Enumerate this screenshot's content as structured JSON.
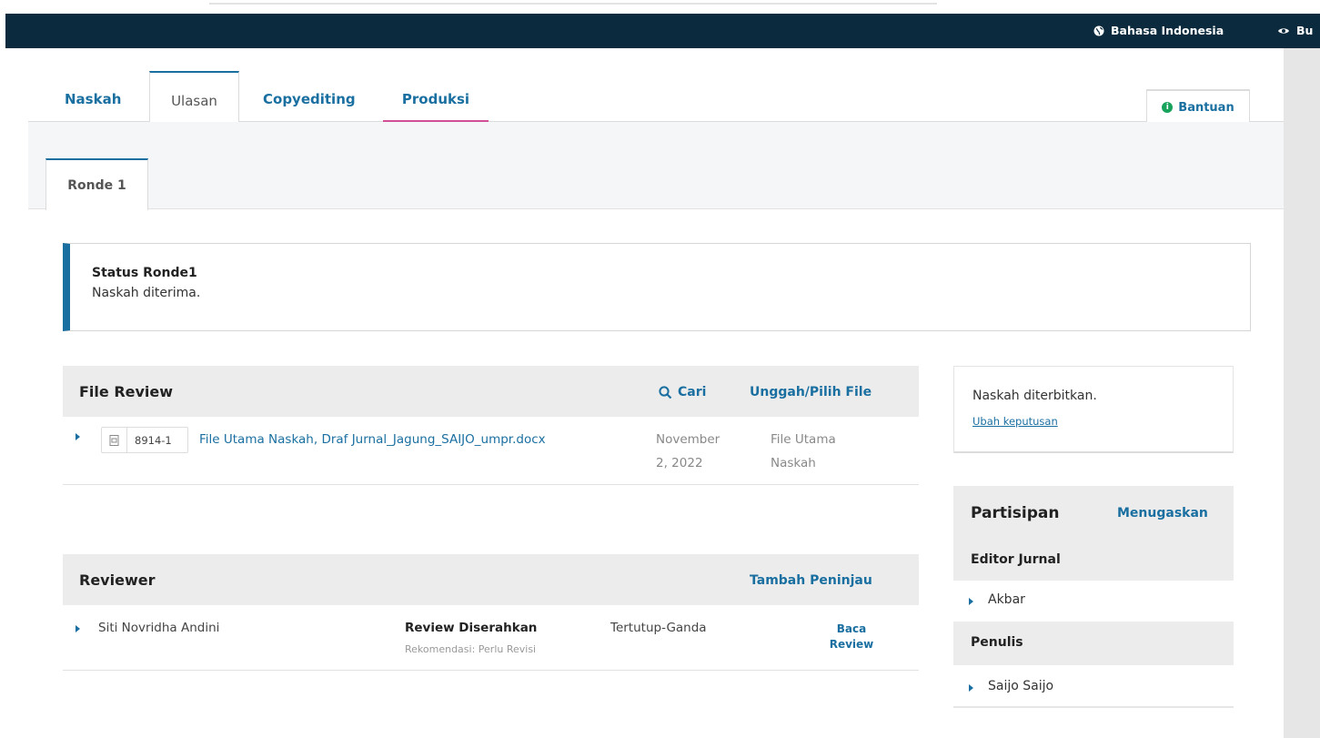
{
  "header": {
    "language_label": "Bahasa Indonesia",
    "view_label": "Bu",
    "globe_icon": "globe-icon",
    "eye_icon": "eye-icon"
  },
  "tabs": {
    "naskah": "Naskah",
    "ulasan": "Ulasan",
    "copyediting": "Copyediting",
    "produksi": "Produksi",
    "help": "Bantuan"
  },
  "round": {
    "tab_label": "Ronde 1",
    "status_title": "Status Ronde1",
    "status_text": "Naskah diterima."
  },
  "file_review": {
    "title": "File Review",
    "search_label": "Cari",
    "upload_label": "Unggah/Pilih File",
    "files": [
      {
        "id": "8914-1",
        "name": "File Utama Naskah, Draf Jurnal_Jagung_SAIJO_umpr.docx",
        "date_line1": "November",
        "date_line2": "2, 2022",
        "type_line1": "File Utama",
        "type_line2": "Naskah"
      }
    ]
  },
  "reviewer": {
    "title": "Reviewer",
    "add_label": "Tambah Peninjau",
    "rows": [
      {
        "name": "Siti Novridha Andini",
        "status": "Review Diserahkan",
        "recommendation": "Rekomendasi: Perlu Revisi",
        "method": "Tertutup-Ganda",
        "action_line1": "Baca",
        "action_line2": "Review"
      }
    ]
  },
  "decision": {
    "text": "Naskah diterbitkan.",
    "change_link": "Ubah keputusan"
  },
  "participants": {
    "title": "Partisipan",
    "assign_label": "Menugaskan",
    "groups": [
      {
        "name": "Editor Jurnal",
        "members": [
          "Akbar"
        ]
      },
      {
        "name": "Penulis",
        "members": [
          "Saijo Saijo"
        ]
      }
    ]
  },
  "colors": {
    "header_bg": "#0c2a3d",
    "link_blue": "#1a6fa1",
    "produksi_underline": "#d24e96",
    "help_icon_green": "#17a35c"
  }
}
